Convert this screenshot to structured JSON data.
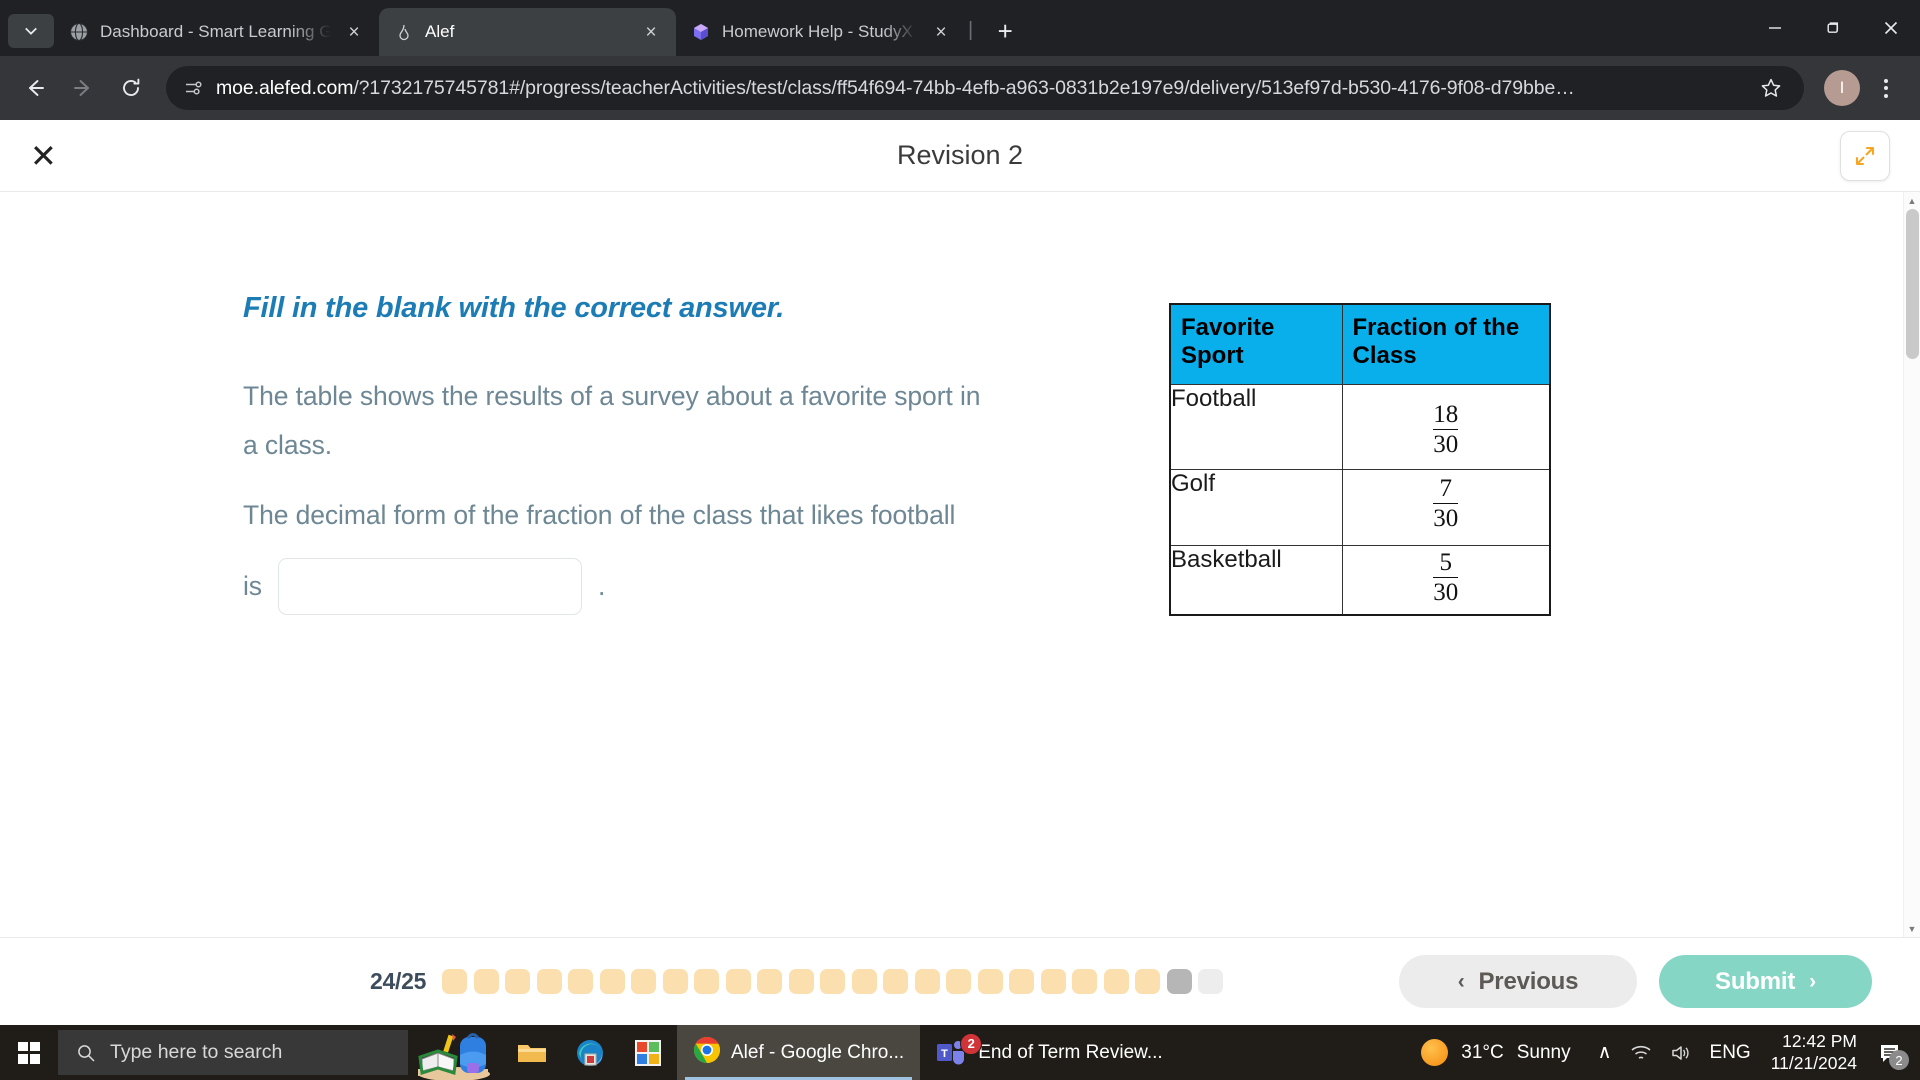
{
  "browser": {
    "tabs": [
      {
        "title": "Dashboard - Smart Learning Ga",
        "favicon": "globe-icon",
        "active": false
      },
      {
        "title": "Alef",
        "favicon": "alef-icon",
        "active": true
      },
      {
        "title": "Homework Help - StudyX",
        "favicon": "studyx-icon",
        "active": false
      }
    ],
    "new_tab_label": "+",
    "tab_close_label": "×",
    "url_prefix": "moe.alefed.com",
    "url_rest": "/?1732175745781#/progress/teacherActivities/test/class/ff54f694-74bb-4efb-a963-0831b2e197e9/delivery/513ef97d-b530-4176-9f08-d79bbe…",
    "profile_initial": "I",
    "window_minimize": "—",
    "window_maximize": "❐",
    "window_close": "✕"
  },
  "app": {
    "title": "Revision 2",
    "close_label": "✕"
  },
  "question": {
    "instruction": "Fill in the blank with the correct answer.",
    "line1": "The table shows the results of a survey about a favorite sport in",
    "line2": "a class.",
    "line3": "The decimal form of the fraction of the class that likes football",
    "answer_prefix": "is",
    "answer_value": "",
    "answer_placeholder": "",
    "period": "."
  },
  "table": {
    "headers": [
      "Favorite Sport",
      "Fraction of the Class"
    ],
    "rows": [
      {
        "sport": "Football",
        "numerator": "18",
        "denominator": "30"
      },
      {
        "sport": "Golf",
        "numerator": "7",
        "denominator": "30"
      },
      {
        "sport": "Basketball",
        "numerator": "5",
        "denominator": "30"
      }
    ],
    "header_bg": "#08AFEB"
  },
  "footer": {
    "progress_text": "24/25",
    "total_dots": 25,
    "answered_dots": 23,
    "current_dot_index": 23,
    "previous_label": "Previous",
    "previous_chevron": "‹",
    "submit_label": "Submit",
    "submit_chevron": "›",
    "submit_color": "#86D6C6"
  },
  "taskbar": {
    "search_placeholder": "Type here to search",
    "apps": [
      {
        "label": "Alef - Google Chro...",
        "icon": "chrome-icon",
        "active": true,
        "badge": ""
      },
      {
        "label": "End of Term Review...",
        "icon": "teams-icon",
        "active": false,
        "badge": "2"
      }
    ],
    "weather_temp": "31°C",
    "weather_desc": "Sunny",
    "language": "ENG",
    "time": "12:42 PM",
    "date": "11/21/2024",
    "notification_count": "2",
    "tray_chevron": "∧"
  }
}
